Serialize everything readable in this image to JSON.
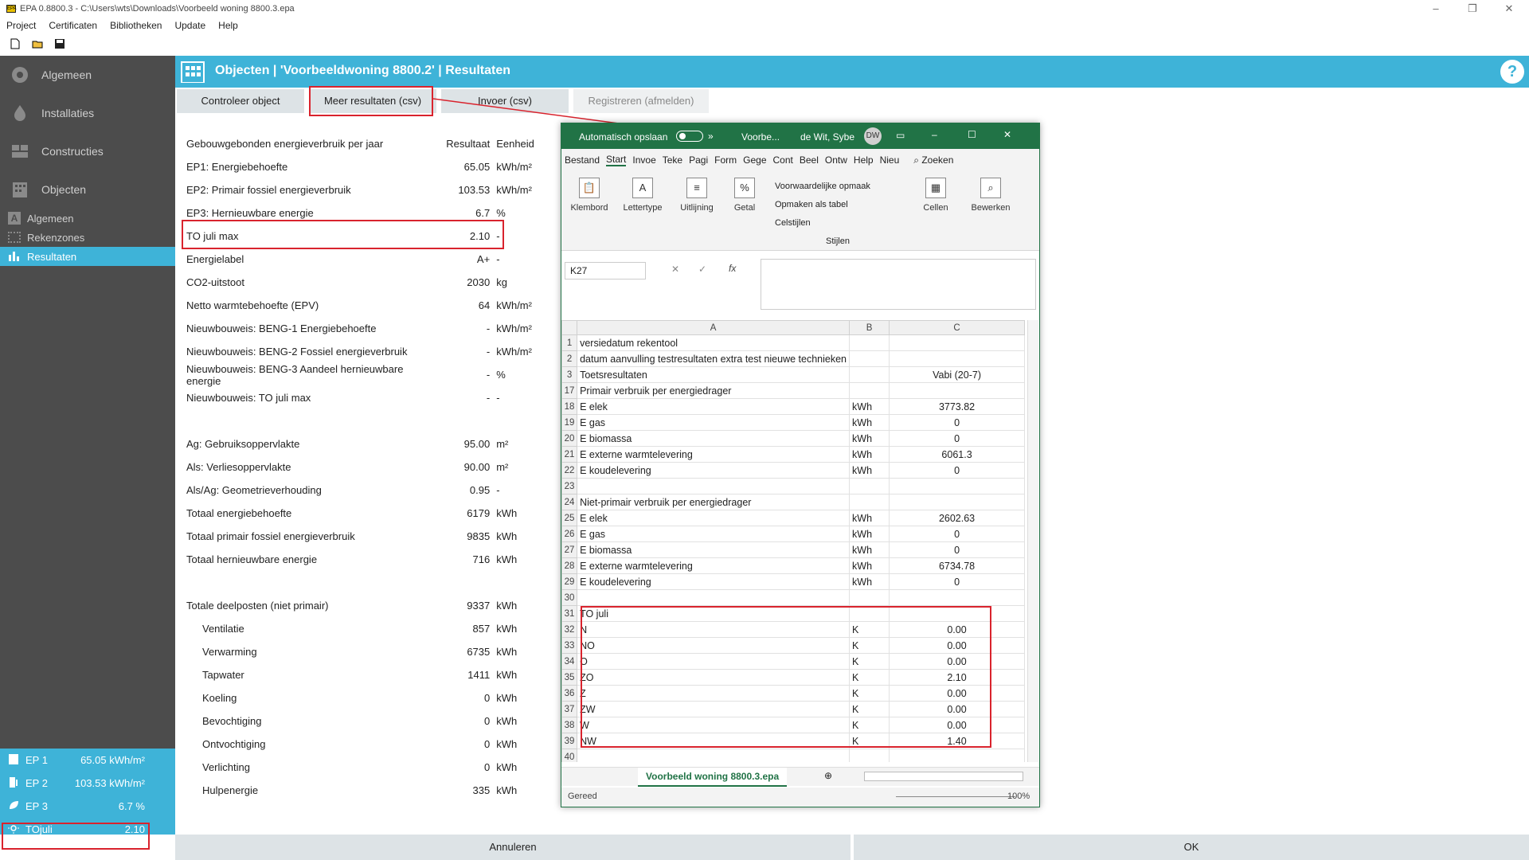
{
  "window": {
    "title": "EPA 0.8800.3 - C:\\Users\\wts\\Downloads\\Voorbeeld woning 8800.3.epa",
    "icon_text": "EPA"
  },
  "menu": [
    "Project",
    "Certificaten",
    "Bibliotheken",
    "Update",
    "Help"
  ],
  "sidebar": {
    "items": [
      {
        "label": "Algemeen",
        "icon": "gear-icon"
      },
      {
        "label": "Installaties",
        "icon": "flame-icon"
      },
      {
        "label": "Constructies",
        "icon": "wall-icon"
      },
      {
        "label": "Objecten",
        "icon": "building-icon"
      }
    ],
    "sub": [
      {
        "label": "Algemeen",
        "icon": "letter-a-icon"
      },
      {
        "label": "Rekenzones",
        "icon": "zones-icon"
      },
      {
        "label": "Resultaten",
        "icon": "bar-chart-icon",
        "active": true
      }
    ]
  },
  "summary": [
    {
      "k": "EP 1",
      "v": "65.05 kWh/m²",
      "icon": "building-icon"
    },
    {
      "k": "EP 2",
      "v": "103.53 kWh/m²",
      "icon": "fuel-pump-icon"
    },
    {
      "k": "EP 3",
      "v": "6.7 %",
      "icon": "leaf-icon"
    },
    {
      "k": "TOjuli",
      "v": "2.10",
      "icon": "sun-icon"
    }
  ],
  "header": {
    "title": "Objecten | 'Voorbeeldwoning 8800.2' | Resultaten",
    "help": "?"
  },
  "tabs": [
    "Controleer object",
    "Meer resultaten (csv)",
    "Invoer (csv)",
    "Registreren (afmelden)"
  ],
  "results": {
    "header": {
      "label": "Gebouwgebonden energieverbruik per jaar",
      "value": "Resultaat",
      "unit": "Eenheid"
    },
    "rows": [
      {
        "label": "EP1: Energiebehoefte",
        "value": "65.05",
        "unit": "kWh/m²"
      },
      {
        "label": "EP2: Primair fossiel energieverbruik",
        "value": "103.53",
        "unit": "kWh/m²"
      },
      {
        "label": "EP3: Hernieuwbare energie",
        "value": "6.7",
        "unit": "%"
      },
      {
        "label": "TO juli max",
        "value": "2.10",
        "unit": "-"
      },
      {
        "label": "Energielabel",
        "value": "A+",
        "unit": "-"
      },
      {
        "label": "CO2-uitstoot",
        "value": "2030",
        "unit": "kg"
      },
      {
        "label": "Netto warmtebehoefte (EPV)",
        "value": "64",
        "unit": "kWh/m²"
      },
      {
        "label": "Nieuwbouweis: BENG-1 Energiebehoefte",
        "value": "-",
        "unit": "kWh/m²"
      },
      {
        "label": "Nieuwbouweis: BENG-2 Fossiel energieverbruik",
        "value": "-",
        "unit": "kWh/m²"
      },
      {
        "label": "Nieuwbouweis: BENG-3 Aandeel hernieuwbare energie",
        "value": "-",
        "unit": "%"
      },
      {
        "label": "Nieuwbouweis: TO juli max",
        "value": "-",
        "unit": "-"
      },
      {
        "gap": true
      },
      {
        "label": "Ag: Gebruiksoppervlakte",
        "value": "95.00",
        "unit": "m²"
      },
      {
        "label": "Als: Verliesoppervlakte",
        "value": "90.00",
        "unit": "m²"
      },
      {
        "label": "Als/Ag: Geometrieverhouding",
        "value": "0.95",
        "unit": "-"
      },
      {
        "label": "Totaal energiebehoefte",
        "value": "6179",
        "unit": "kWh"
      },
      {
        "label": "Totaal primair fossiel energieverbruik",
        "value": "9835",
        "unit": "kWh"
      },
      {
        "label": "Totaal hernieuwbare energie",
        "value": "716",
        "unit": "kWh"
      },
      {
        "gap": true
      },
      {
        "label": "Totale deelposten (niet primair)",
        "value": "9337",
        "unit": "kWh"
      },
      {
        "label": "Ventilatie",
        "value": "857",
        "unit": "kWh",
        "indent": true
      },
      {
        "label": "Verwarming",
        "value": "6735",
        "unit": "kWh",
        "indent": true
      },
      {
        "label": "Tapwater",
        "value": "1411",
        "unit": "kWh",
        "indent": true
      },
      {
        "label": "Koeling",
        "value": "0",
        "unit": "kWh",
        "indent": true
      },
      {
        "label": "Bevochtiging",
        "value": "0",
        "unit": "kWh",
        "indent": true
      },
      {
        "label": "Ontvochtiging",
        "value": "0",
        "unit": "kWh",
        "indent": true
      },
      {
        "label": "Verlichting",
        "value": "0",
        "unit": "kWh",
        "indent": true
      },
      {
        "label": "Hulpenergie",
        "value": "335",
        "unit": "kWh",
        "indent": true
      }
    ]
  },
  "footer": {
    "cancel": "Annuleren",
    "ok": "OK"
  },
  "excel": {
    "autosave": "Automatisch opslaan",
    "filename": "Voorbe...",
    "user": "de Wit, Sybe",
    "initials": "DW",
    "ribbon_tabs": [
      "Bestand",
      "Start",
      "Invoe",
      "Teke",
      "Pagi",
      "Form",
      "Gege",
      "Cont",
      "Beel",
      "Ontw",
      "Help",
      "Nieu"
    ],
    "search": "Zoeken",
    "groups": [
      "Klembord",
      "Lettertype",
      "Uitlijning",
      "Getal"
    ],
    "styles": [
      "Voorwaardelijke opmaak",
      "Opmaken als tabel",
      "Celstijlen"
    ],
    "styles_label": "Stijlen",
    "cells": "Cellen",
    "edit": "Bewerken",
    "namebox": "K27",
    "fx": "fx",
    "col_headers": [
      "A",
      "B",
      "C"
    ],
    "rows": [
      [
        "1",
        "versiedatum rekentool",
        "",
        ""
      ],
      [
        "2",
        "datum aanvulling testresultaten extra test nieuwe technieken",
        "",
        ""
      ],
      [
        "3",
        "Toetsresultaten",
        "",
        "Vabi (20-7)"
      ],
      [
        "17",
        "Primair verbruik per energiedrager",
        "",
        ""
      ],
      [
        "18",
        "E elek",
        "kWh",
        "3773.82"
      ],
      [
        "19",
        "E gas",
        "kWh",
        "0"
      ],
      [
        "20",
        "E biomassa",
        "kWh",
        "0"
      ],
      [
        "21",
        "E externe warmtelevering",
        "kWh",
        "6061.3"
      ],
      [
        "22",
        "E koudelevering",
        "kWh",
        "0"
      ],
      [
        "23",
        "",
        "",
        ""
      ],
      [
        "24",
        "Niet-primair verbruik per energiedrager",
        "",
        ""
      ],
      [
        "25",
        "E elek",
        "kWh",
        "2602.63"
      ],
      [
        "26",
        "E gas",
        "kWh",
        "0"
      ],
      [
        "27",
        "E biomassa",
        "kWh",
        "0"
      ],
      [
        "28",
        "E externe warmtelevering",
        "kWh",
        "6734.78"
      ],
      [
        "29",
        "E koudelevering",
        "kWh",
        "0"
      ],
      [
        "30",
        "",
        "",
        ""
      ],
      [
        "31",
        "TO juli",
        "",
        ""
      ],
      [
        "32",
        "N",
        "K",
        "0.00"
      ],
      [
        "33",
        "NO",
        "K",
        "0.00"
      ],
      [
        "34",
        "O",
        "K",
        "0.00"
      ],
      [
        "35",
        "ZO",
        "K",
        "2.10"
      ],
      [
        "36",
        "Z",
        "K",
        "0.00"
      ],
      [
        "37",
        "ZW",
        "K",
        "0.00"
      ],
      [
        "38",
        "W",
        "K",
        "0.00"
      ],
      [
        "39",
        "NW",
        "K",
        "1.40"
      ],
      [
        "40",
        "",
        "",
        ""
      ]
    ],
    "sheet_tab": "Voorbeeld woning 8800.3.epa",
    "status": "Gereed",
    "zoom": "100%"
  }
}
